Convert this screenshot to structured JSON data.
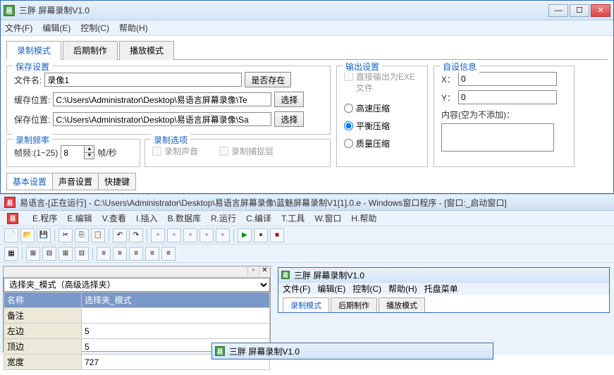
{
  "window": {
    "icon_text": "易",
    "title": "三胖    屏幕录制V1.0"
  },
  "menubar": [
    "文件(F)",
    "编辑(E)",
    "控制(C)",
    "帮助(H)"
  ],
  "tabs": {
    "t1": "录制模式",
    "t2": "后期制作",
    "t3": "播放模式"
  },
  "save_settings": {
    "legend": "保存设置",
    "filename_lbl": "文件名:",
    "filename_val": "录像1",
    "exists_btn": "是否存在",
    "cache_lbl": "缓存位置:",
    "cache_val": "C:\\Users\\Administrator\\Desktop\\易语言屏幕录像\\Te",
    "save_lbl": "保存位置:",
    "save_val": "C:\\Users\\Administrator\\Desktop\\易语言屏幕录像\\Sa",
    "select_btn": "选择"
  },
  "freq": {
    "legend": "录制频率",
    "lbl": "帧频:(1~25)",
    "val": "8",
    "unit": "帧/秒"
  },
  "options": {
    "legend": "录制选项",
    "sound": "录制声音",
    "capture": "录制捕捉层"
  },
  "output": {
    "legend": "输出设置",
    "exe": "直接输出为EXE文件",
    "fast": "高速压缩",
    "balance": "平衡压缩",
    "quality": "质量压缩"
  },
  "custom": {
    "legend": "自设信息",
    "x_lbl": "X：",
    "x_val": "0",
    "y_lbl": "Y：",
    "y_val": "0",
    "content_lbl": "内容(空为不添加)："
  },
  "bottom_tabs": {
    "t1": "基本设置",
    "t2": "声音设置",
    "t3": "快捷键"
  },
  "ide": {
    "icon_text": "易",
    "title": "易语言-[正在运行] - C:\\Users\\Administrator\\Desktop\\易语言屏幕录像\\蓝魅屏幕录制V1[1].0.e - Windows窗口程序 - [窗口:_启动窗口]",
    "menu": [
      "E.程序",
      "E.编辑",
      "V.查看",
      "I.插入",
      "B.数据库",
      "R.运行",
      "C.编译",
      "T.工具",
      "W.窗口",
      "H.帮助"
    ]
  },
  "prop": {
    "select": "选择夹_模式（高级选择夹）",
    "rows": [
      {
        "k": "名称",
        "v": "选择夹_模式"
      },
      {
        "k": "备注",
        "v": ""
      },
      {
        "k": "左边",
        "v": "5"
      },
      {
        "k": "顶边",
        "v": "5"
      },
      {
        "k": "宽度",
        "v": "727"
      }
    ]
  },
  "nested": {
    "title": "三胖    屏幕录制V1.0",
    "menu": [
      "文件(F)",
      "编辑(E)",
      "控制(C)",
      "帮助(H)",
      "托盘菜单"
    ],
    "tabs": [
      "录制模式",
      "后期制作",
      "播放模式"
    ]
  },
  "float": {
    "title": "三胖    屏幕录制V1.0"
  }
}
